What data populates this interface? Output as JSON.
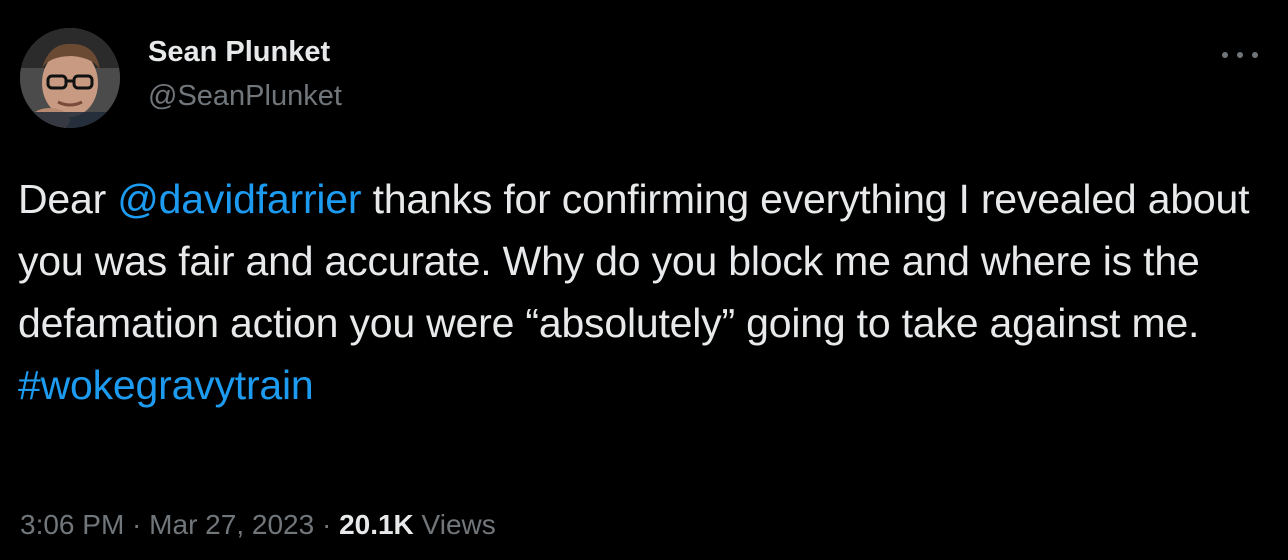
{
  "author": {
    "name": "Sean Plunket",
    "handle": "@SeanPlunket"
  },
  "tweet": {
    "text_before": "Dear ",
    "mention": "@davidfarrier",
    "text_after": " thanks for confirming everything I revealed about you was fair and accurate. Why do you block me and where is the defamation action you were “absolutely” going to take against me. ",
    "hashtag": "#wokegravytrain"
  },
  "meta": {
    "time": "3:06 PM",
    "separator": " · ",
    "date": "Mar 27, 2023",
    "views_count": "20.1K",
    "views_label": " Views"
  },
  "icons": {
    "more": "more-horizontal-icon"
  },
  "colors": {
    "background": "#000000",
    "text": "#e7e9ea",
    "secondary": "#71767b",
    "link": "#1d9bf0"
  }
}
